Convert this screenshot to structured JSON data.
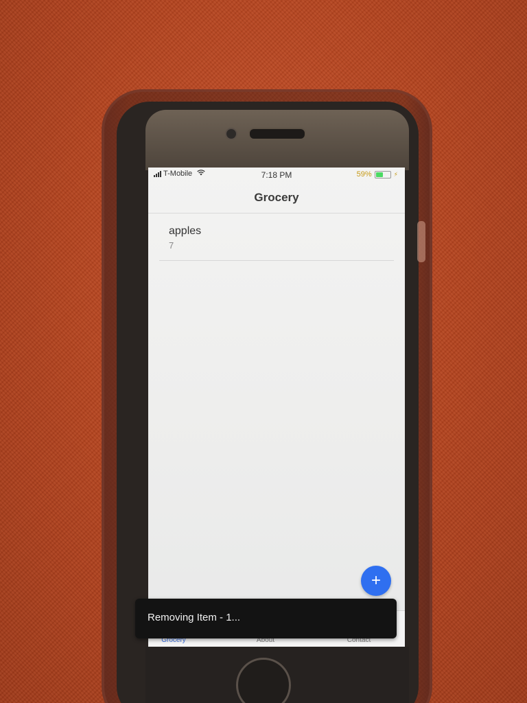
{
  "status_bar": {
    "carrier": "T-Mobile",
    "time": "7:18 PM",
    "battery_percent": "59%",
    "battery_level": 0.59,
    "icons": [
      "signal-icon",
      "wifi-icon",
      "battery-icon",
      "charging-icon"
    ]
  },
  "nav": {
    "title": "Grocery"
  },
  "list": {
    "items": [
      {
        "name": "apples",
        "quantity": "7"
      }
    ]
  },
  "fab": {
    "symbol": "+",
    "icon": "plus-icon",
    "color": "#2f6ff0"
  },
  "tabs": [
    {
      "label": "Grocery",
      "active": true
    },
    {
      "label": "About",
      "active": false
    },
    {
      "label": "Contact",
      "active": false
    }
  ],
  "toast": {
    "message": "Removing Item - 1..."
  },
  "colors": {
    "accent": "#3b6fe0",
    "battery_text": "#c79a17",
    "battery_fill": "#4cd964"
  }
}
